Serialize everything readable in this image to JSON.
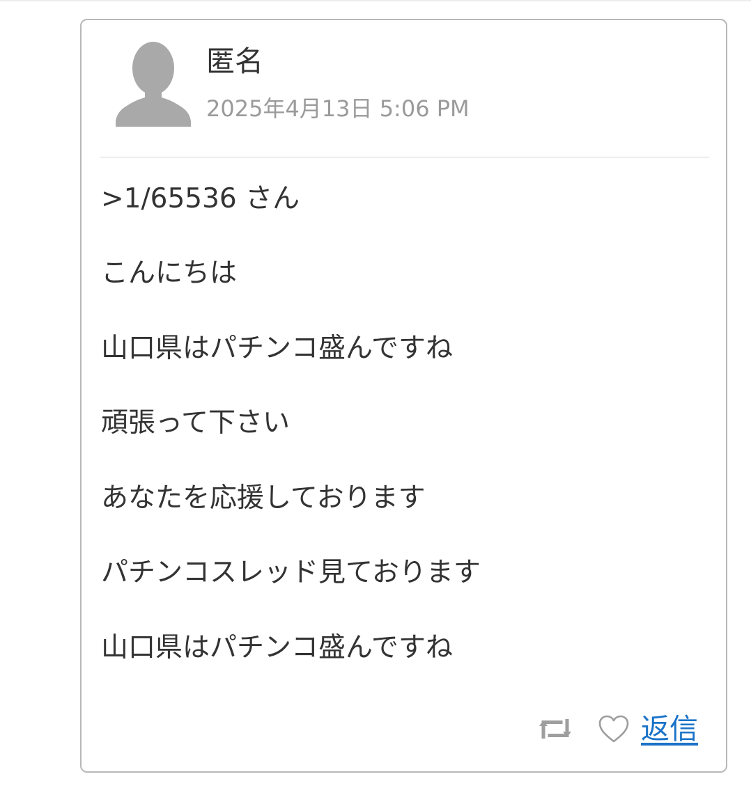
{
  "comment": {
    "author": "匿名",
    "timestamp": "2025年4月13日 5:06 PM",
    "lines": [
      ">1/65536 さん",
      "こんにちは",
      "山口県はパチンコ盛んですね",
      "頑張って下さい",
      "あなたを応援しております",
      "パチンコスレッド見ております",
      "山口県はパチンコ盛んですね"
    ]
  },
  "actions": {
    "retweet_icon": "retweet-icon",
    "like_icon": "heart-icon",
    "reply_label": "返信"
  },
  "colors": {
    "text": "#333333",
    "muted": "#9a9a9a",
    "link": "#1a73c8",
    "icon": "#9e9e9e",
    "border": "#b8b8b8"
  }
}
